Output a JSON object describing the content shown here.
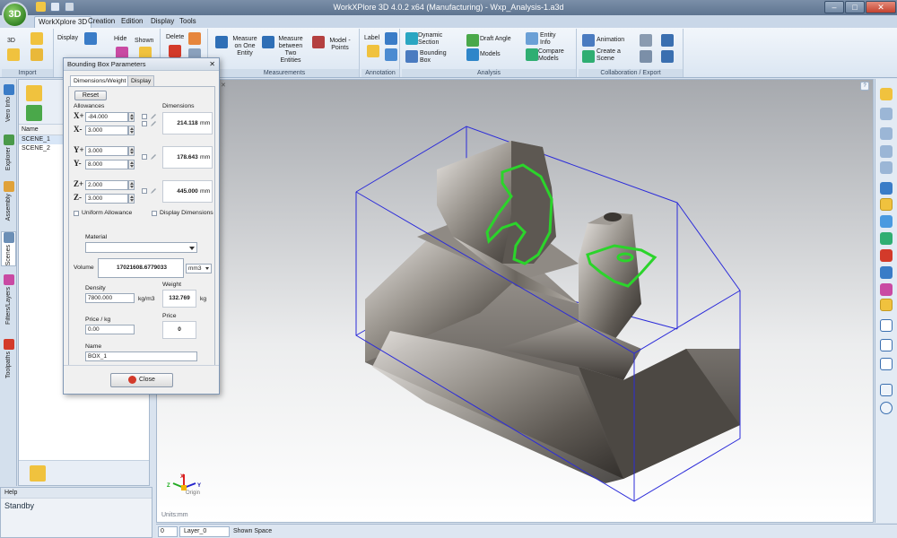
{
  "window": {
    "title": "WorkXPlore 3D 4.0.2 x64 (Manufacturing) - Wxp_Analysis-1.a3d",
    "logo_text": "3D",
    "minimize": "–",
    "maximize": "□",
    "close": "✕"
  },
  "tabs": [
    "WorkXplore 3D",
    "Creation",
    "Edition",
    "Display",
    "Tools"
  ],
  "ribbon": {
    "import": {
      "label": "Import",
      "btn_3d": "3D"
    },
    "display": {
      "display": "Display",
      "hide": "Hide",
      "shown": "Shown"
    },
    "delete": {
      "label": "Delete"
    },
    "measurements": {
      "label": "Measurements",
      "on_one_entity": "Measure on One Entity",
      "between_two": "Measure between Two Entities",
      "model_points": "Model - Points"
    },
    "annotation": {
      "label": "Annotation",
      "label_btn": "Label"
    },
    "analysis": {
      "label": "Analysis",
      "dynamic_section": "Dynamic Section",
      "bounding_box": "Bounding Box",
      "draft_angle": "Draft Angle",
      "models": "Models",
      "entity_info": "Entity Info",
      "compare_models": "Compare Models"
    },
    "collab": {
      "label": "Collaboration / Export",
      "animation": "Animation",
      "create_scene": "Create a Scene"
    }
  },
  "vtabs": [
    "Vero Info",
    "Explorer",
    "Assembly",
    "Scenes",
    "Filters/Layers",
    "Toolpaths"
  ],
  "left_panel": {
    "column_header": "Name",
    "scenes": [
      "SCENE_1",
      "SCENE_2"
    ]
  },
  "dialog": {
    "title": "Bounding Box Parameters",
    "close_x": "✕",
    "tabs": [
      "Dimensions/Weight",
      "Display"
    ],
    "reset": "Reset",
    "allowances_label": "Allowances",
    "dimensions_label": "Dimensions",
    "axes": [
      {
        "plus_label": "X+",
        "minus_label": "X-",
        "plus": "-84.000",
        "minus": "3.000",
        "dimension": "214.118",
        "unit": "mm"
      },
      {
        "plus_label": "Y+",
        "minus_label": "Y-",
        "plus": "3.000",
        "minus": "8.000",
        "dimension": "178.643",
        "unit": "mm"
      },
      {
        "plus_label": "Z+",
        "minus_label": "Z-",
        "plus": "2.000",
        "minus": "3.000",
        "dimension": "445.000",
        "unit": "mm"
      }
    ],
    "uniform_allowance": "Uniform Allowance",
    "display_dimensions": "Display Dimensions",
    "material_label": "Material",
    "material_value": "",
    "volume_label": "Volume",
    "volume_value": "17021608.6779033",
    "volume_unit": "mm3",
    "density_label": "Density",
    "density_value": "7800.000",
    "density_unit": "kg/m3",
    "weight_label": "Weight",
    "weight_value": "132.769",
    "weight_unit": "kg",
    "price_kg_label": "Price / kg",
    "price_kg_value": "0.00",
    "price_label": "Price",
    "price_value": "0",
    "name_label": "Name",
    "name_value": "BOX_1",
    "close_btn": "Close"
  },
  "viewport": {
    "units": "Units:mm",
    "origin_label": "Origin",
    "triad": {
      "x": "X",
      "y": "Y",
      "z": "Z"
    },
    "help": "?",
    "tab_close": "✕"
  },
  "help": {
    "title": "Help",
    "text": "Standby"
  },
  "status": {
    "field_value": "0",
    "layer": "Layer_0",
    "shown_space": "Shown Space"
  },
  "colors": {
    "accent": "#3b6ea5",
    "section": "#2bd42b",
    "bbox": "#2b2bd9"
  }
}
